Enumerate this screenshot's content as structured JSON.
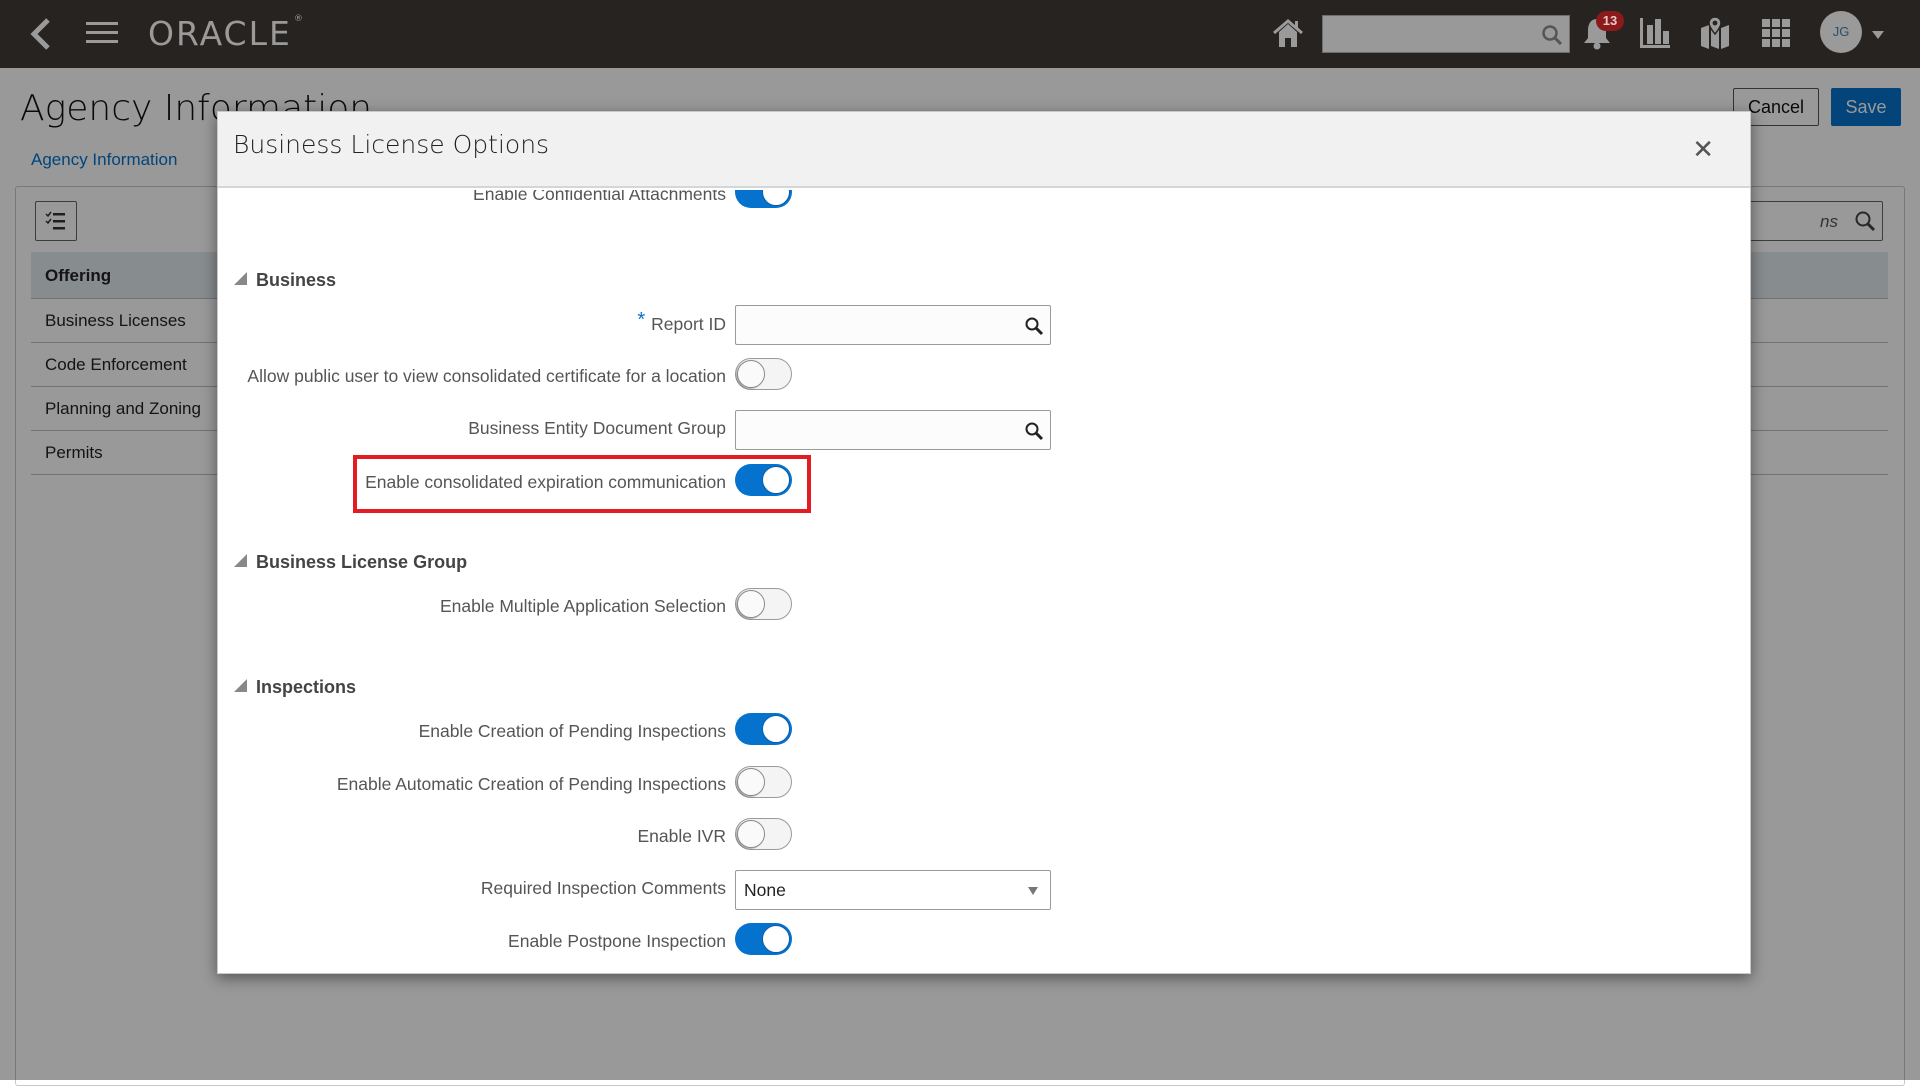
{
  "topbar": {
    "back_icon": "chevron-left-icon",
    "menu_icon": "hamburger-menu-icon",
    "logo": "ORACLE",
    "logo_mark": "®",
    "home_icon": "home-icon",
    "search_placeholder": "",
    "notifications_count": "13",
    "avatar_initials": "JG"
  },
  "page": {
    "title": "Agency Information",
    "cancel_label": "Cancel",
    "save_label": "Save",
    "breadcrumb": "Agency Information",
    "search_placeholder": "ns",
    "nav_items": [
      {
        "label": "Offering",
        "active": true
      },
      {
        "label": "Business Licenses"
      },
      {
        "label": "Code Enforcement"
      },
      {
        "label": "Planning and Zoning"
      },
      {
        "label": "Permits"
      }
    ]
  },
  "dialog": {
    "title": "Business License Options",
    "close_icon": "close-icon",
    "partial_row": {
      "label": "Enable Confidential Attachments",
      "value": true
    },
    "sections": [
      {
        "title": "Business",
        "fields": [
          {
            "label": "Report ID",
            "type": "lov",
            "required": true,
            "value": ""
          },
          {
            "label": "Allow public user to view consolidated certificate for a location",
            "type": "toggle",
            "value": false
          },
          {
            "label": "Business Entity Document Group",
            "type": "lov",
            "value": ""
          },
          {
            "label": "Enable consolidated expiration communication",
            "type": "toggle",
            "value": true,
            "highlighted": true
          }
        ]
      },
      {
        "title": "Business License Group",
        "fields": [
          {
            "label": "Enable Multiple Application Selection",
            "type": "toggle",
            "value": false
          }
        ]
      },
      {
        "title": "Inspections",
        "fields": [
          {
            "label": "Enable Creation of Pending Inspections",
            "type": "toggle",
            "value": true
          },
          {
            "label": "Enable Automatic Creation of Pending Inspections",
            "type": "toggle",
            "value": false
          },
          {
            "label": "Enable IVR",
            "type": "toggle",
            "value": false
          },
          {
            "label": "Required Inspection Comments",
            "type": "select",
            "value": "None"
          },
          {
            "label": "Enable Postpone Inspection",
            "type": "toggle",
            "value": true
          }
        ]
      }
    ]
  },
  "colors": {
    "topbar_bg": "#262321",
    "accent": "#0572ce",
    "highlight_border": "#e31b23",
    "badge": "#8b1a1a"
  }
}
